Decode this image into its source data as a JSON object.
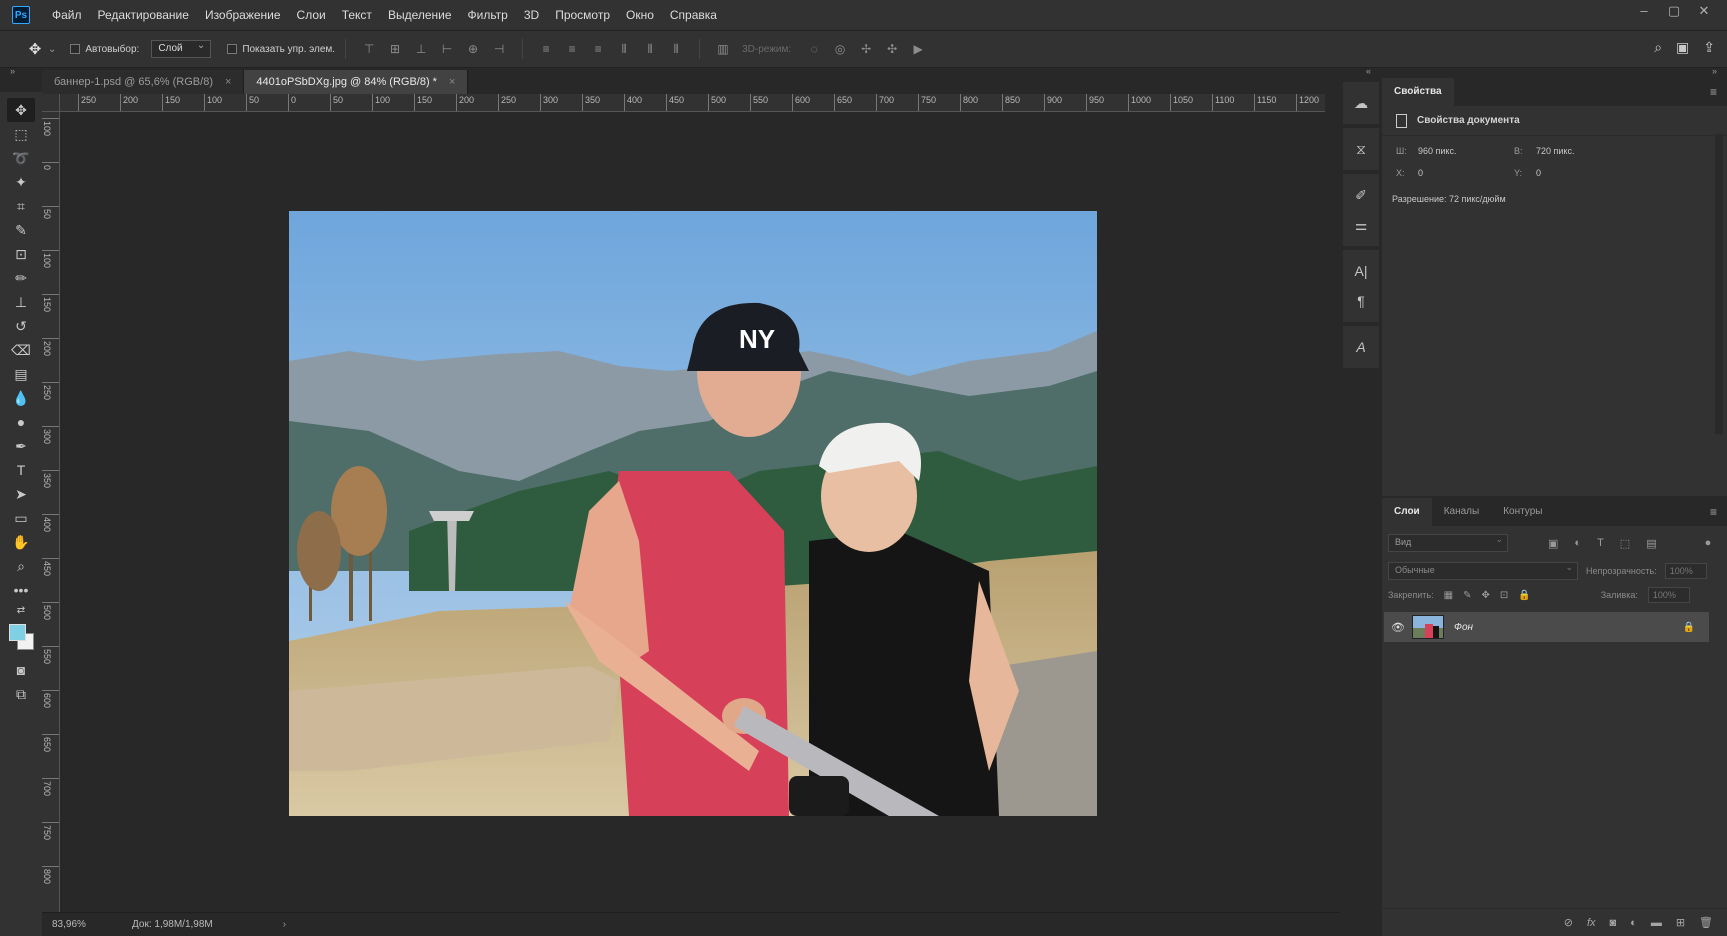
{
  "app": {
    "logo": "Ps"
  },
  "menu": [
    "Файл",
    "Редактирование",
    "Изображение",
    "Слои",
    "Текст",
    "Выделение",
    "Фильтр",
    "3D",
    "Просмотр",
    "Окно",
    "Справка"
  ],
  "window_controls": {
    "minimize": "–",
    "restore": "▢",
    "close": "✕"
  },
  "options": {
    "autoselect_label": "Автовыбор:",
    "autoselect_value": "Слой",
    "show_controls_label": "Показать упр. элем.",
    "mode3d_label": "3D-режим:"
  },
  "tabs": [
    {
      "label": "баннер-1.psd @ 65,6% (RGB/8)",
      "close": "×"
    },
    {
      "label": "4401oPSbDXg.jpg @ 84% (RGB/8) *",
      "close": "×"
    }
  ],
  "ruler_top": [
    "250",
    "200",
    "150",
    "100",
    "50",
    "0",
    "50",
    "100",
    "150",
    "200",
    "250",
    "300",
    "350",
    "400",
    "450",
    "500",
    "550",
    "600",
    "650",
    "700",
    "750",
    "800",
    "850",
    "900",
    "950",
    "1000",
    "1050",
    "1100",
    "1150",
    "1200"
  ],
  "ruler_left": [
    "100",
    "0",
    "50",
    "100",
    "150",
    "200",
    "250",
    "300",
    "350",
    "400",
    "450",
    "500",
    "550",
    "600",
    "650",
    "700",
    "750",
    "800"
  ],
  "status": {
    "zoom": "83,96%",
    "doc": "Док: 1,98M/1,98M",
    "arrow": "›"
  },
  "properties": {
    "tab": "Свойства",
    "subtitle": "Свойства документа",
    "w_label": "Ш:",
    "w_value": "960 пикс.",
    "h_label": "В:",
    "h_value": "720 пикс.",
    "x_label": "X:",
    "x_value": "0",
    "y_label": "Y:",
    "y_value": "0",
    "resolution": "Разрешение: 72 пикс/дюйм"
  },
  "layers_panel": {
    "tabs": [
      "Слои",
      "Каналы",
      "Контуры"
    ],
    "search_placeholder": "Вид",
    "blend_mode": "Обычные",
    "opacity_label": "Непрозрачность:",
    "opacity_value": "100%",
    "lock_label": "Закрепить:",
    "fill_label": "Заливка:",
    "fill_value": "100%",
    "layer_name": "Фон"
  },
  "colors": {
    "foreground": "#7fd0e4",
    "background": "#f2f2f2",
    "accent": "#31a8ff"
  }
}
